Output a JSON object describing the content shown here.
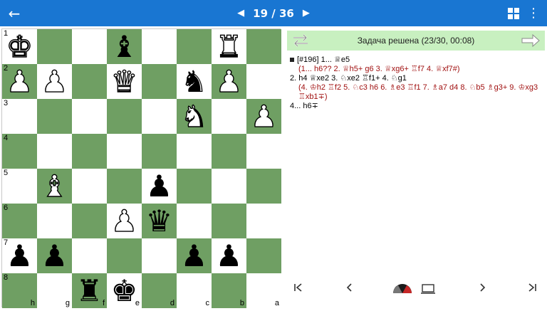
{
  "header": {
    "back_icon": "arrow-left-icon",
    "counter": "19 / 36",
    "prev_icon": "triangle-left-icon",
    "next_icon": "triangle-right-icon",
    "grid_icon": "grid-view-icon",
    "more_icon": "more-vertical-icon",
    "color": "#1976d2"
  },
  "board": {
    "colors": {
      "light": "#ffffff",
      "dark": "#6f9f63"
    },
    "ranks": [
      "1",
      "2",
      "3",
      "4",
      "5",
      "6",
      "7",
      "8"
    ],
    "files": [
      "h",
      "g",
      "f",
      "e",
      "d",
      "c",
      "b",
      "a"
    ],
    "rows": [
      [
        "wK",
        "",
        "",
        "bB",
        "",
        "",
        "wR",
        ""
      ],
      [
        "wP",
        "wP",
        "",
        "wQ",
        "",
        "bN",
        "wP",
        ""
      ],
      [
        "",
        "",
        "",
        "",
        "",
        "wN",
        "",
        "wP"
      ],
      [
        "",
        "",
        "",
        "",
        "",
        "",
        "",
        ""
      ],
      [
        "",
        "wB",
        "",
        "",
        "bP",
        "",
        "",
        ""
      ],
      [
        "",
        "",
        "",
        "wP",
        "bQ",
        "",
        "",
        ""
      ],
      [
        "bP",
        "bP",
        "",
        "",
        "",
        "bP",
        "bP",
        ""
      ],
      [
        "",
        "",
        "bR",
        "bK",
        "",
        "",
        "",
        ""
      ]
    ]
  },
  "status": {
    "text": "Задача решена (23/30, 00:08)",
    "background": "#c8f0c0",
    "flip_icon": "swap-arrows-icon",
    "next_icon": "arrow-right-outline-icon"
  },
  "moves": {
    "line1": "[#196] 1... ♕e5",
    "line2": "(1... h6?? 2. ♕h5+ g6 3. ♕xg6+ ♖f7 4. ♕xf7#)",
    "line3": "2. h4 ♕xe2 3. ♘xe2 ♖f1+ 4. ♘g1",
    "line4": "(4. ♔h2 ♖f2 5. ♘c3 h6 6. ♗e3 ♖f1 7. ♗a7 d4 8. ♘b5 ♗g3+ 9. ♔xg3",
    "line5": "♖xb1∓)",
    "line6": "4... h6∓"
  },
  "controls": {
    "first": "|◀",
    "prev": "‹",
    "next": "›",
    "last": "▶|",
    "gauge_icon": "evaluation-gauge-icon",
    "laptop_icon": "laptop-icon"
  }
}
